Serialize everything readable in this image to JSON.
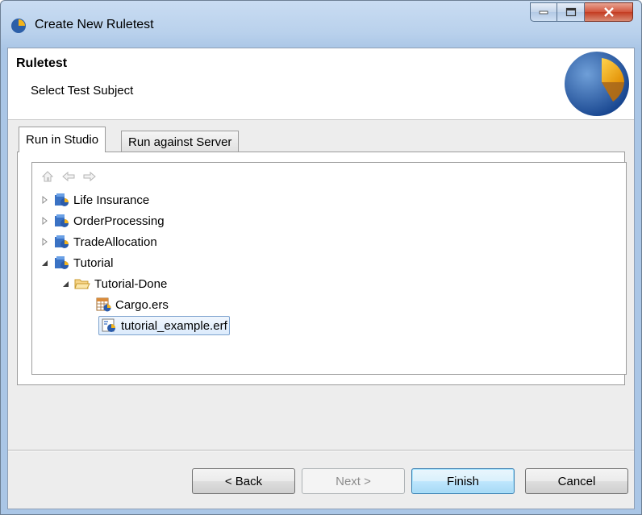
{
  "window": {
    "title": "Create New Ruletest",
    "accent": "#aac6e6"
  },
  "header": {
    "title": "Ruletest",
    "subtitle": "Select Test Subject"
  },
  "tabs": [
    {
      "label": "Run in Studio",
      "active": true
    },
    {
      "label": "Run against Server",
      "active": false
    }
  ],
  "tree": {
    "nav_icons": [
      "home-icon",
      "back-arrow-icon",
      "forward-arrow-icon"
    ],
    "nodes": [
      {
        "label": "Life Insurance",
        "type": "project",
        "expanded": false
      },
      {
        "label": "OrderProcessing",
        "type": "project",
        "expanded": false
      },
      {
        "label": "TradeAllocation",
        "type": "project",
        "expanded": false
      },
      {
        "label": "Tutorial",
        "type": "project",
        "expanded": true
      },
      {
        "label": "Tutorial-Done",
        "type": "folder",
        "expanded": true
      },
      {
        "label": "Cargo.ers",
        "type": "ruleset-file"
      },
      {
        "label": "tutorial_example.erf",
        "type": "ruleflow-file",
        "selected": true
      }
    ]
  },
  "buttons": {
    "back": "< Back",
    "next": "Next >",
    "finish": "Finish",
    "cancel": "Cancel"
  }
}
